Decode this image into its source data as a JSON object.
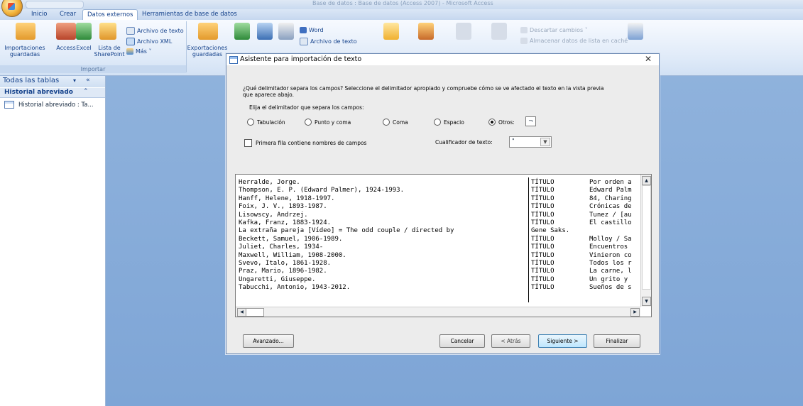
{
  "window": {
    "title": "Base de datos : Base de datos (Access 2007) - Microsoft Access"
  },
  "ribbon_tabs": [
    {
      "label": "Inicio",
      "active": false
    },
    {
      "label": "Crear",
      "active": false
    },
    {
      "label": "Datos externos",
      "active": true
    },
    {
      "label": "Herramientas de base de datos",
      "active": false
    }
  ],
  "ribbon": {
    "importaciones_guardadas": "Importaciones\nguardadas",
    "access": "Access",
    "excel": "Excel",
    "lista_sharepoint": "Lista de\nSharePoint",
    "archivo_texto": "Archivo de texto",
    "archivo_xml": "Archivo XML",
    "mas": "Más ˅",
    "exportaciones_guardadas": "Exportaciones\nguardadas",
    "word": "Word",
    "archivo_texto_export": "Archivo de texto",
    "descartar_cambios": "Descartar cambios ˅",
    "almacenar_datos": "Almacenar datos de lista en caché",
    "group_importar": "Importar"
  },
  "nav": {
    "title": "Todas las tablas",
    "dropdown": "▾",
    "collapse": "«",
    "group_label": "Historial abreviado",
    "group_toggle": "⌃",
    "item_label": "Historial abreviado : Ta..."
  },
  "dialog": {
    "title": "Asistente para importación de texto",
    "close": "✕",
    "question": "¿Qué delimitador separa los campos? Seleccione el delimitador apropiado y compruebe cómo se ve afectado el texto en la vista previa que aparece abajo.",
    "delimiter_legend": "Elija el delimitador que separa los campos:",
    "delimiters": [
      {
        "label": "Tabulación",
        "selected": false
      },
      {
        "label": "Punto y coma",
        "selected": false
      },
      {
        "label": "Coma",
        "selected": false
      },
      {
        "label": "Espacio",
        "selected": false
      },
      {
        "label": "Otros:",
        "selected": true
      }
    ],
    "otros_value": "¬",
    "first_row_label": "Primera fila contiene nombres de campos",
    "first_row_checked": false,
    "qualifier_label": "Cualificador de texto:",
    "qualifier_value": "\"",
    "preview_rows": [
      [
        "Herralde, Jorge.",
        "TÍTULO",
        "Por orden a"
      ],
      [
        "Thompson, E. P. (Edward Palmer), 1924-1993.",
        "TÍTULO",
        "Edward Palm"
      ],
      [
        "Hanff, Helene, 1918-1997.",
        "TÍTULO",
        "84, Charing"
      ],
      [
        "Foix, J. V., 1893-1987.",
        "TÍTULO",
        "Crónicas de"
      ],
      [
        "Lisowscy, Andrzej.",
        "TÍTULO",
        "Tunez / [au"
      ],
      [
        "Kafka, Franz, 1883-1924.",
        "TÍTULO",
        "El castillo"
      ],
      [
        "La extraña pareja [Vídeo] = The odd couple / directed by",
        "Gene Saks.",
        ""
      ],
      [
        "Beckett, Samuel, 1906-1989.",
        "TÍTULO",
        "Molloy / Sa"
      ],
      [
        "Juliet, Charles, 1934-",
        "TÍTULO",
        "Encuentros"
      ],
      [
        "Maxwell, William, 1908-2000.",
        "TÍTULO",
        "Vinieron co"
      ],
      [
        "Svevo, Italo, 1861-1928.",
        "TÍTULO",
        "Todos los r"
      ],
      [
        "Praz, Mario, 1896-1982.",
        "TÍTULO",
        "La carne, l"
      ],
      [
        "Ungaretti, Giuseppe.",
        "TÍTULO",
        "Un grito y"
      ],
      [
        "Tabucchi, Antonio, 1943-2012.",
        "TÍTULO",
        "Sueños de s"
      ]
    ],
    "buttons": {
      "avanzado": "Avanzado...",
      "cancelar": "Cancelar",
      "atras": "< Atrás",
      "siguiente": "Siguiente >",
      "finalizar": "Finalizar"
    }
  },
  "colors": {
    "workspace": "#8fb2dc",
    "ribbon_text": "#15428b"
  }
}
